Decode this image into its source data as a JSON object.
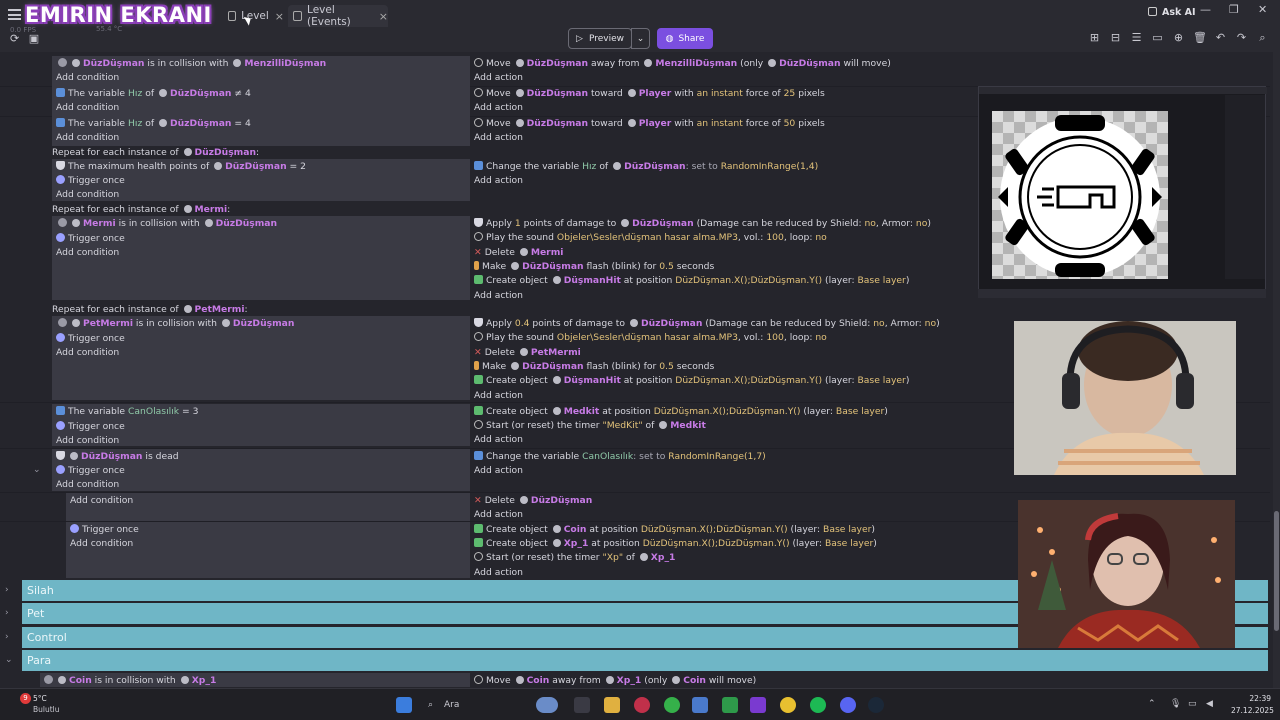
{
  "overlay_title": "EMIRIN EKRANI",
  "tabs": [
    {
      "label": "Level"
    },
    {
      "label": "Level (Events)"
    }
  ],
  "stream_stats": {
    "fps": "0.0 FPS",
    "temp": "55.4 °C"
  },
  "ask_ai": "Ask AI",
  "toolbar": {
    "preview": "Preview",
    "share": "Share"
  },
  "events": {
    "r1": {
      "cond_a": "is in collision with",
      "obj_a": "DüzDüşman",
      "obj_b": "MenzilliDüşman",
      "add_condition": "Add condition",
      "act_move": "Move",
      "act_obj": "DüzDüşman",
      "act_away": "away from",
      "act_target": "MenzilliDüşman",
      "act_only": "(only",
      "act_only_obj": "DüzDüşman",
      "act_will": "will move)",
      "add_action": "Add action"
    },
    "r2": {
      "the_var": "The variable",
      "var": "Hız",
      "of": "of",
      "obj": "DüzDüşman",
      "op": "≠ 4",
      "move": "Move",
      "toward": "toward",
      "target": "Player",
      "with": "with",
      "instant": "an instant",
      "force": "force of",
      "force_val": "25",
      "pixels": "pixels"
    },
    "r3": {
      "op": "= 4",
      "force_val": "50"
    },
    "repeat1": {
      "label": "Repeat for each instance of",
      "obj": "DüzDüşman"
    },
    "r4": {
      "cond": "The maximum health points of",
      "obj": "DüzDüşman",
      "op": "= 2",
      "trigger": "Trigger once",
      "act": "Change the variable",
      "var": "Hız",
      "of": "of",
      "obj2": "DüzDüşman",
      "set": ": set to",
      "val": "RandomInRange(1,4)"
    },
    "repeat2": {
      "label": "Repeat for each instance of",
      "obj": "Mermi"
    },
    "r5": {
      "obj": "Mermi",
      "cond": "is in collision with",
      "obj2": "DüzDüşman",
      "trigger": "Trigger once",
      "a1": "Apply",
      "a1_num": "1",
      "a1_mid": "points of damage to",
      "a1_obj": "DüzDüşman",
      "a1_tail": "(Damage can be reduced by Shield:",
      "a1_no1": "no",
      "a1_armor": ", Armor:",
      "a1_no2": "no",
      "a1_end": ")",
      "a2": "Play the sound",
      "a2_file": "Objeler\\Sesler\\düşman hasar alma.MP3",
      "a2_vol": ", vol.:",
      "a2_vol_val": "100",
      "a2_loop": ", loop:",
      "a2_loop_val": "no",
      "a3": "Delete",
      "a3_obj": "Mermi",
      "a4": "Make",
      "a4_obj": "DüzDüşman",
      "a4_mid": "flash (blink) for",
      "a4_val": "0.5",
      "a4_end": "seconds",
      "a5": "Create object",
      "a5_obj": "DüşmanHit",
      "a5_mid": "at position",
      "a5_pos": "DüzDüşman.X();DüzDüşman.Y()",
      "a5_layer": "(layer:",
      "a5_layer_val": "Base layer",
      "a5_end": ")"
    },
    "repeat3": {
      "label": "Repeat for each instance of",
      "obj": "PetMermi"
    },
    "r6": {
      "obj": "PetMermi",
      "cond": "is in collision with",
      "obj2": "DüzDüşman",
      "trigger": "Trigger once",
      "a1_num": "0.4",
      "a3_obj": "PetMermi",
      "a5_obj": "DüşmanHit"
    },
    "r7": {
      "the_var": "The variable",
      "var": "CanOlasılık",
      "op": "= 3",
      "trigger": "Trigger once",
      "a1": "Create object",
      "a1_obj": "Medkit",
      "a1_mid": "at position",
      "a1_pos": "DüzDüşman.X();DüzDüşman.Y()",
      "a1_layer": "(layer:",
      "a1_layer_val": "Base layer",
      "a1_end": ")",
      "a2": "Start (or reset) the timer",
      "a2_name": "\"MedKit\"",
      "a2_of": "of",
      "a2_obj": "Medkit"
    },
    "r8": {
      "obj": "DüzDüşman",
      "cond": "is dead",
      "trigger": "Trigger once",
      "act": "Change the variable",
      "var": "CanOlasılık",
      "set": ": set to",
      "val": "RandomInRange(1,7)"
    },
    "r9": {
      "act": "Delete",
      "obj": "DüzDüşman"
    },
    "r10": {
      "trigger": "Trigger once",
      "a1": "Create object",
      "a1_obj": "Coin",
      "a1_mid": "at position",
      "a1_pos": "DüzDüşman.X();DüzDüşman.Y()",
      "a1_layer": "(layer:",
      "a1_layer_val": "Base layer",
      "a1_end": ")",
      "a2_obj": "Xp_1",
      "a3": "Start (or reset) the timer",
      "a3_name": "\"Xp\"",
      "a3_of": "of",
      "a3_obj": "Xp_1"
    },
    "groups": [
      "Silah",
      "Pet",
      "Control",
      "Para"
    ],
    "r11": {
      "obj": "Coin",
      "cond": "is in collision with",
      "obj2": "Xp_1",
      "act": "Move",
      "act_obj": "Coin",
      "act_away": "away from",
      "act_target": "Xp_1",
      "act_only": "(only",
      "act_only_obj": "Coin",
      "act_will": "will move)"
    }
  },
  "taskbar": {
    "weather_temp": "5°C",
    "weather_desc": "Bulutlu",
    "notif_count": "9",
    "search_placeholder": "Ara",
    "time": "22:39",
    "date": "27.12.2025"
  },
  "colors": {
    "accent": "#7b4fe0",
    "group": "#6fb6c6",
    "object": "#c77be6"
  }
}
